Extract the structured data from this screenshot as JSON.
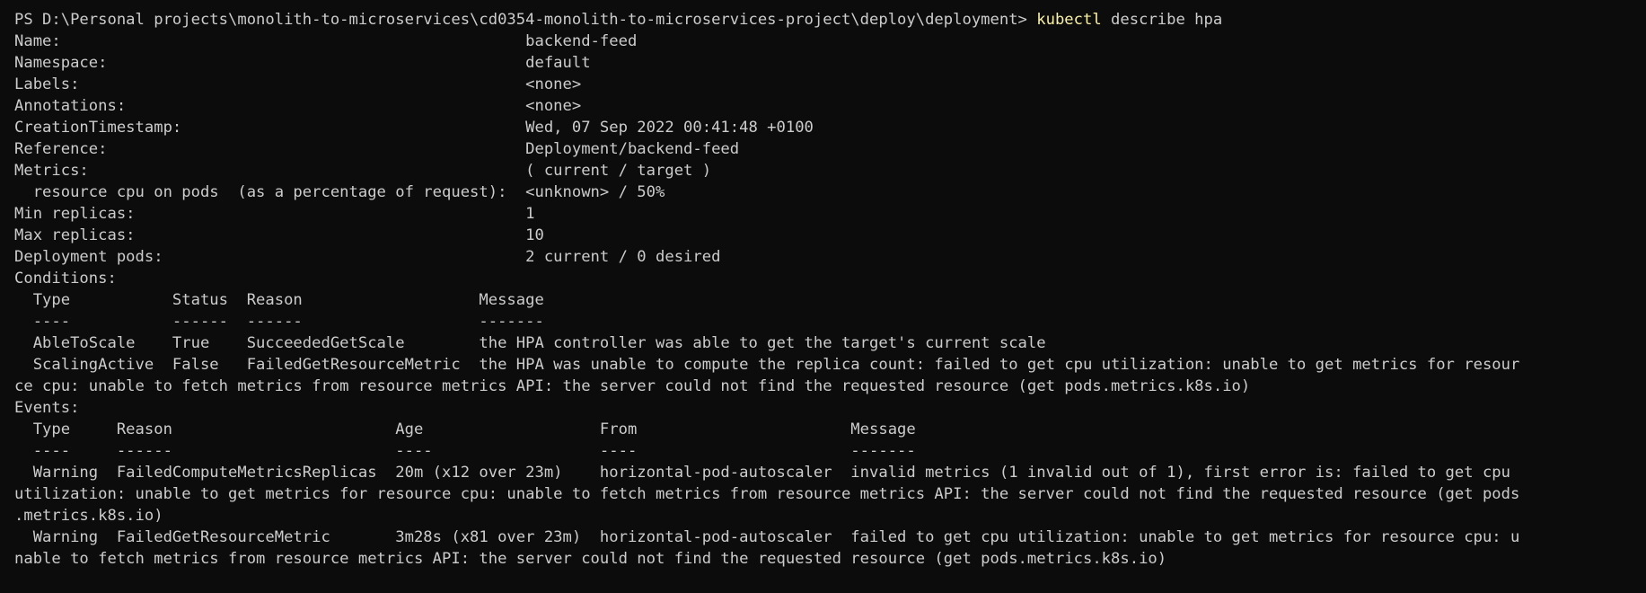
{
  "terminal": {
    "prompt": "PS D:\\Personal projects\\monolith-to-microservices\\cd0354-monolith-to-microservices-project\\deploy\\deployment> ",
    "command": "kubectl",
    "args": " describe hpa",
    "output": [
      "Name:                                                  backend-feed",
      "Namespace:                                             default",
      "Labels:                                                <none>",
      "Annotations:                                           <none>",
      "CreationTimestamp:                                     Wed, 07 Sep 2022 00:41:48 +0100",
      "Reference:                                             Deployment/backend-feed",
      "Metrics:                                               ( current / target )",
      "  resource cpu on pods  (as a percentage of request):  <unknown> / 50%",
      "Min replicas:                                          1",
      "Max replicas:                                          10",
      "Deployment pods:                                       2 current / 0 desired",
      "Conditions:",
      "  Type           Status  Reason                   Message",
      "  ----           ------  ------                   -------",
      "  AbleToScale    True    SucceededGetScale        the HPA controller was able to get the target's current scale",
      "  ScalingActive  False   FailedGetResourceMetric  the HPA was unable to compute the replica count: failed to get cpu utilization: unable to get metrics for resour",
      "ce cpu: unable to fetch metrics from resource metrics API: the server could not find the requested resource (get pods.metrics.k8s.io)",
      "Events:",
      "  Type     Reason                        Age                   From                       Message",
      "  ----     ------                        ----                  ----                       -------",
      "  Warning  FailedComputeMetricsReplicas  20m (x12 over 23m)    horizontal-pod-autoscaler  invalid metrics (1 invalid out of 1), first error is: failed to get cpu",
      "utilization: unable to get metrics for resource cpu: unable to fetch metrics from resource metrics API: the server could not find the requested resource (get pods",
      ".metrics.k8s.io)",
      "  Warning  FailedGetResourceMetric       3m28s (x81 over 23m)  horizontal-pod-autoscaler  failed to get cpu utilization: unable to get metrics for resource cpu: u",
      "nable to fetch metrics from resource metrics API: the server could not find the requested resource (get pods.metrics.k8s.io)"
    ]
  },
  "colors": {
    "background": "#0c0c0c",
    "foreground": "#cccccc",
    "command_highlight": "#f9f1a5"
  }
}
